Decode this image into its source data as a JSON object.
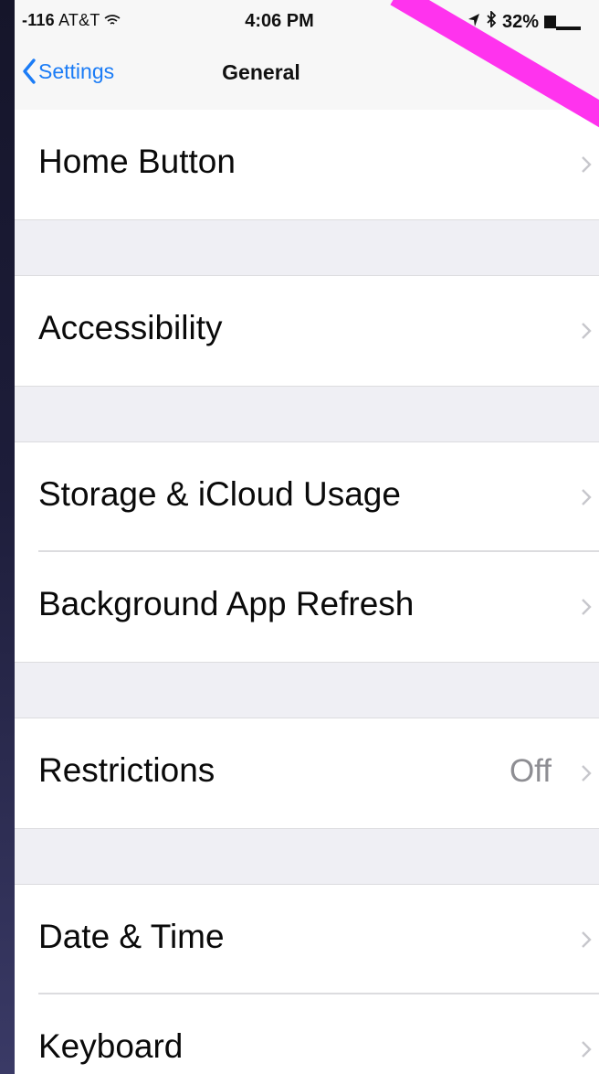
{
  "status_bar": {
    "signal": "-116",
    "carrier": "AT&T",
    "time": "4:06 PM",
    "battery_percent": "32%",
    "battery_level": 0.32
  },
  "nav": {
    "back_label": "Settings",
    "title": "General"
  },
  "rows": [
    {
      "label": "Home Button",
      "value": ""
    },
    {
      "label": "Accessibility",
      "value": ""
    },
    {
      "label": "Storage & iCloud Usage",
      "value": ""
    },
    {
      "label": "Background App Refresh",
      "value": ""
    },
    {
      "label": "Restrictions",
      "value": "Off"
    },
    {
      "label": "Date & Time",
      "value": ""
    },
    {
      "label": "Keyboard",
      "value": ""
    }
  ],
  "colors": {
    "tint": "#1b7cf6",
    "annotation": "#ff33ee",
    "background": "#efeff4"
  },
  "icons": [
    "wifi-icon",
    "location-arrow-icon",
    "bluetooth-icon",
    "battery-icon",
    "back-chevron-icon",
    "disclosure-chevron-icon"
  ]
}
